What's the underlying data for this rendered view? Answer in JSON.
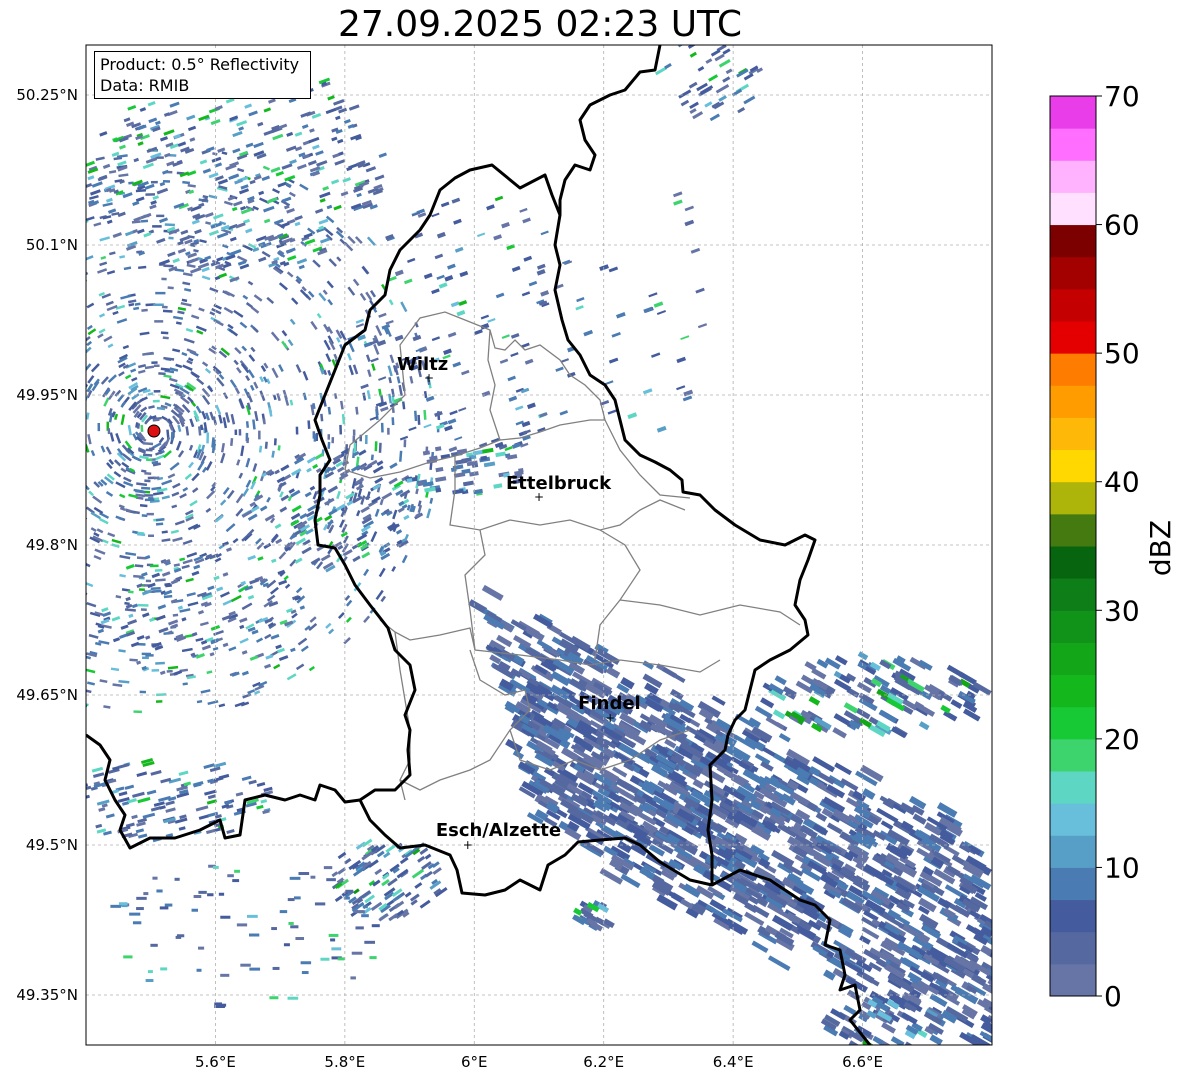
{
  "title": "27.09.2025 02:23 UTC",
  "info": {
    "product": "Product: 0.5° Reflectivity",
    "data_source": "Data: RMIB"
  },
  "map": {
    "lat_ticks": [
      "50.25°N",
      "50.1°N",
      "49.95°N",
      "49.8°N",
      "49.65°N",
      "49.5°N",
      "49.35°N"
    ],
    "lon_ticks": [
      "5.6°E",
      "5.8°E",
      "6°E",
      "6.2°E",
      "6.4°E",
      "6.6°E"
    ],
    "lat_values": [
      50.25,
      50.1,
      49.95,
      49.8,
      49.65,
      49.5,
      49.35
    ],
    "lon_values": [
      5.6,
      5.8,
      6.0,
      6.2,
      6.4,
      6.6
    ],
    "extent": {
      "lon_min": 5.4,
      "lon_max": 6.8,
      "lat_min": 49.3,
      "lat_max": 50.3
    },
    "cities": [
      {
        "name": "Wiltz",
        "lon": 5.93,
        "lat": 49.967
      },
      {
        "name": "Ettelbruck",
        "lon": 6.1,
        "lat": 49.848
      },
      {
        "name": "Findel",
        "lon": 6.21,
        "lat": 49.627
      },
      {
        "name": "Esch/Alzette",
        "lon": 5.99,
        "lat": 49.5
      }
    ],
    "radar_site": {
      "lon": 5.505,
      "lat": 49.914,
      "color": "#dd1111"
    },
    "border_color": "#000000",
    "canton_color": "#808080"
  },
  "colorbar": {
    "label": "dBZ",
    "ticks": [
      "0",
      "10",
      "20",
      "30",
      "40",
      "50",
      "60",
      "70"
    ],
    "min": 0,
    "max": 70,
    "colors": [
      "#6675a6",
      "#5568a0",
      "#445c9d",
      "#4a7bb2",
      "#589fc8",
      "#67bfdb",
      "#5dd7c4",
      "#3dd46e",
      "#17c935",
      "#14b81c",
      "#13a618",
      "#11931a",
      "#0e7e19",
      "#08650f",
      "#457a11",
      "#adb40a",
      "#fed800",
      "#feb808",
      "#fe9c00",
      "#fe7d00",
      "#e40000",
      "#c40000",
      "#a30000",
      "#7d0000",
      "#ffe0ff",
      "#ffb3ff",
      "#ff6eff",
      "#e83de8"
    ]
  }
}
